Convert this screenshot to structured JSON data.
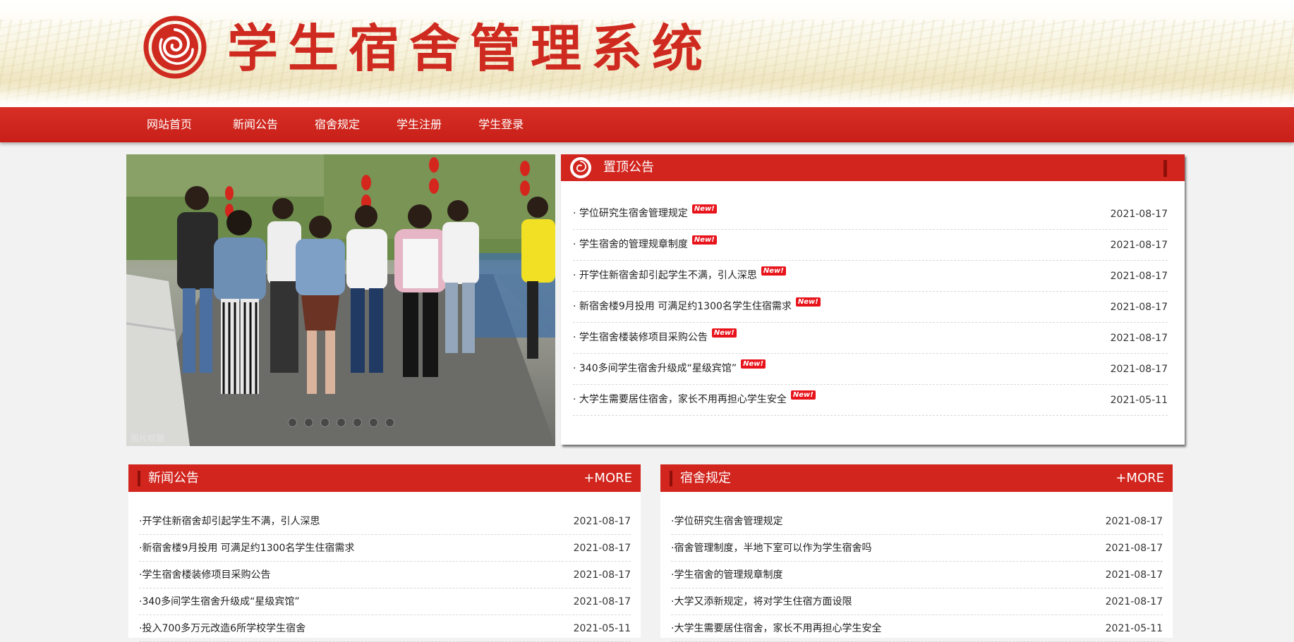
{
  "header": {
    "site_title": "学生宿舍管理系统",
    "logo_icon": "rose-emblem-icon"
  },
  "nav": {
    "items": [
      {
        "label": "网站首页"
      },
      {
        "label": "新闻公告"
      },
      {
        "label": "宿舍规定"
      },
      {
        "label": "学生注册"
      },
      {
        "label": "学生登录"
      }
    ]
  },
  "slider": {
    "dot_count": 7,
    "active_dot": 3,
    "watermark": "图片标题"
  },
  "pinned": {
    "title": "置顶公告",
    "badge": "New!",
    "items": [
      {
        "title": "· 学位研究生宿舍管理规定",
        "date": "2021-08-17"
      },
      {
        "title": "· 学生宿舍的管理规章制度",
        "date": "2021-08-17"
      },
      {
        "title": "· 开学住新宿舍却引起学生不满，引人深思",
        "date": "2021-08-17"
      },
      {
        "title": "· 新宿舍楼9月投用 可满足约1300名学生住宿需求",
        "date": "2021-08-17"
      },
      {
        "title": "· 学生宿舍楼装修项目采购公告",
        "date": "2021-08-17"
      },
      {
        "title": "· 340多间学生宿舍升级成“星级宾馆”",
        "date": "2021-08-17"
      },
      {
        "title": "· 大学生需要居住宿舍，家长不用再担心学生安全",
        "date": "2021-05-11"
      }
    ]
  },
  "news": {
    "title": "新闻公告",
    "more": "+MORE",
    "items": [
      {
        "title": "·开学住新宿舍却引起学生不满，引人深思",
        "date": "2021-08-17"
      },
      {
        "title": "·新宿舍楼9月投用 可满足约1300名学生住宿需求",
        "date": "2021-08-17"
      },
      {
        "title": "·学生宿舍楼装修项目采购公告",
        "date": "2021-08-17"
      },
      {
        "title": "·340多间学生宿舍升级成“星级宾馆”",
        "date": "2021-08-17"
      },
      {
        "title": "·投入700多万元改造6所学校学生宿舍",
        "date": "2021-05-11"
      }
    ]
  },
  "rules": {
    "title": "宿舍规定",
    "more": "+MORE",
    "items": [
      {
        "title": "·学位研究生宿舍管理规定",
        "date": "2021-08-17"
      },
      {
        "title": "·宿舍管理制度，半地下室可以作为学生宿舍吗",
        "date": "2021-08-17"
      },
      {
        "title": "·学生宿舍的管理规章制度",
        "date": "2021-08-17"
      },
      {
        "title": "·大学又添新规定，将对学生住宿方面设限",
        "date": "2021-08-17"
      },
      {
        "title": "·大学生需要居住宿舍，家长不用再担心学生安全",
        "date": "2021-05-11"
      }
    ]
  },
  "colors": {
    "brand_red": "#d1251e",
    "accent_dark_red": "#8e0f0a",
    "badge_red": "#e8141c"
  }
}
